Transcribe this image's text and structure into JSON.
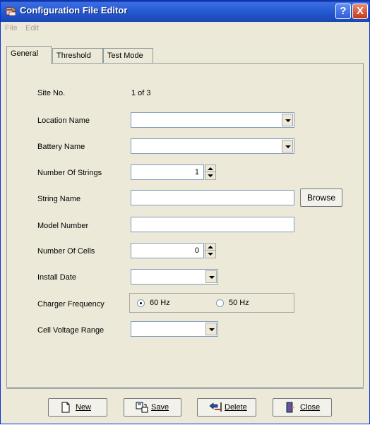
{
  "window": {
    "title": "Configuration File Editor",
    "help_button": "?",
    "close_button": "X"
  },
  "menu": {
    "items": [
      "File",
      "Edit"
    ]
  },
  "tabs": [
    {
      "label": "General",
      "active": true
    },
    {
      "label": "Threshold",
      "active": false
    },
    {
      "label": "Test Mode",
      "active": false
    }
  ],
  "form": {
    "site_no_label": "Site No.",
    "site_no_value": "1 of 3",
    "location_label": "Location Name",
    "location_value": "",
    "battery_label": "Battery Name",
    "battery_value": "",
    "strings_label": "Number Of Strings",
    "strings_value": "1",
    "string_name_label": "String Name",
    "string_name_value": "",
    "browse_label": "Browse",
    "model_label": "Model Number",
    "model_value": "",
    "cells_label": "Number Of Cells",
    "cells_value": "0",
    "install_label": "Install Date",
    "install_value": "",
    "charger_label": "Charger Frequency",
    "charger_options": [
      {
        "label": "60 Hz",
        "checked": true
      },
      {
        "label": "50 Hz",
        "checked": false
      }
    ],
    "cell_voltage_label": "Cell Voltage Range",
    "cell_voltage_value": ""
  },
  "actions": {
    "new": "New",
    "save": "Save",
    "delete": "Delete",
    "close": "Close"
  },
  "icons": {
    "app": "app-icon",
    "new": "new-document-icon",
    "save": "save-icon",
    "delete": "delete-icon",
    "close": "close-door-icon"
  },
  "colors": {
    "titlebar": "#2a5fd8",
    "window_bg": "#ece9d8",
    "field_border": "#7f9db9"
  }
}
